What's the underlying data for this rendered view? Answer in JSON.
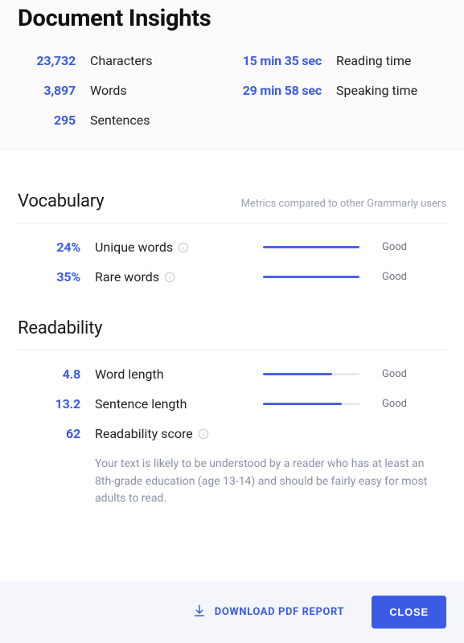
{
  "title": "Document Insights",
  "stats": {
    "characters": {
      "value": "23,732",
      "label": "Characters"
    },
    "words": {
      "value": "3,897",
      "label": "Words"
    },
    "sentences": {
      "value": "295",
      "label": "Sentences"
    },
    "reading_time": {
      "value": "15 min 35 sec",
      "label": "Reading time"
    },
    "speaking_time": {
      "value": "29 min 58 sec",
      "label": "Speaking time"
    }
  },
  "vocabulary": {
    "heading": "Vocabulary",
    "subtitle": "Metrics compared to other Grammarly users",
    "unique_words": {
      "value": "24%",
      "label": "Unique words",
      "rating": "Good",
      "percent": 100
    },
    "rare_words": {
      "value": "35%",
      "label": "Rare words",
      "rating": "Good",
      "percent": 100
    }
  },
  "readability": {
    "heading": "Readability",
    "word_length": {
      "value": "4.8",
      "label": "Word length",
      "rating": "Good",
      "percent": 72
    },
    "sentence_length": {
      "value": "13.2",
      "label": "Sentence length",
      "rating": "Good",
      "percent": 82
    },
    "score": {
      "value": "62",
      "label": "Readability score"
    },
    "description": "Your text is likely to be understood by a reader who has at least an 8th-grade education (age 13-14) and should be fairly easy for most adults to read."
  },
  "footer": {
    "download_label": "DOWNLOAD PDF REPORT",
    "close_label": "CLOSE"
  }
}
